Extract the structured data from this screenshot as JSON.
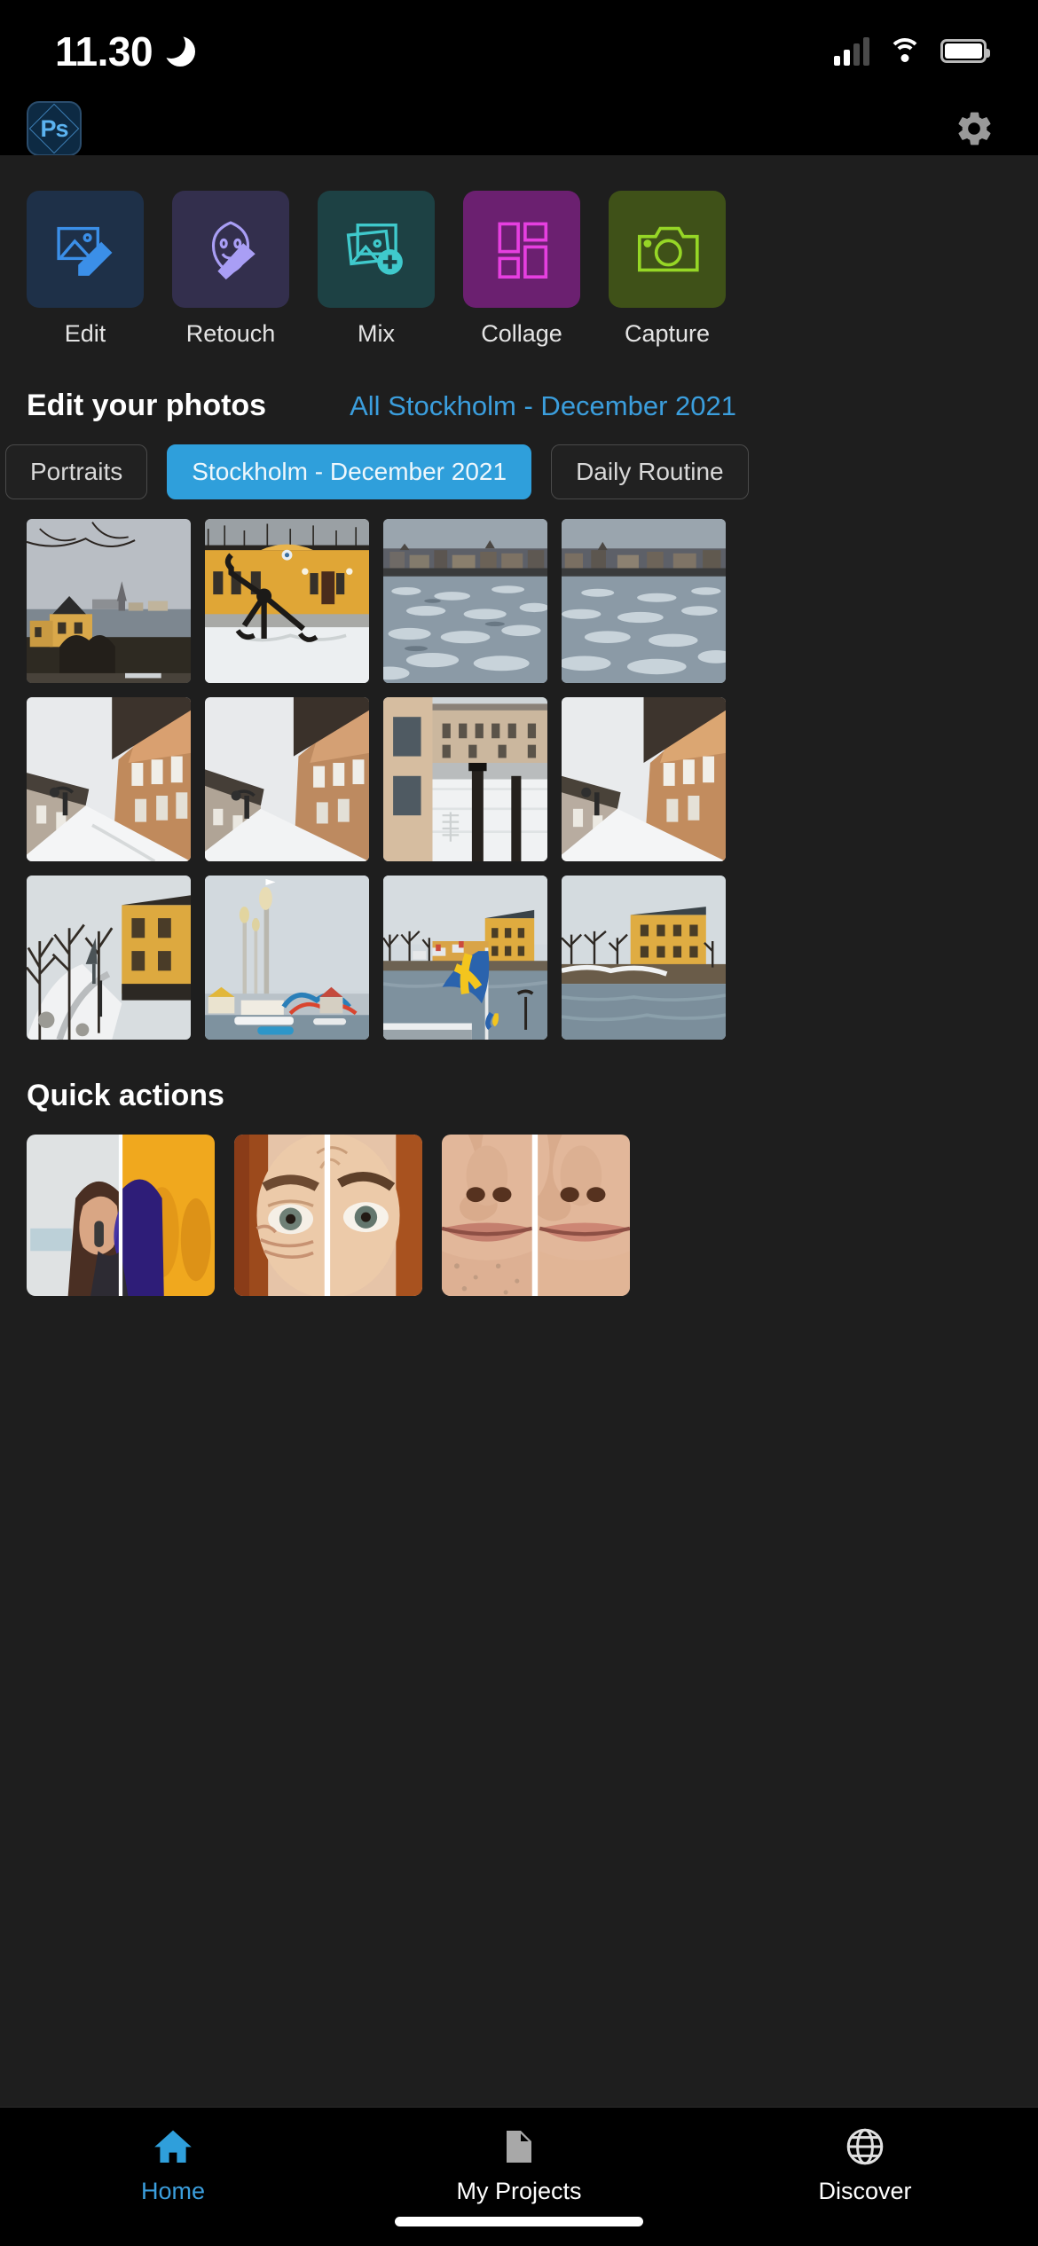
{
  "status_bar": {
    "time": "11.30",
    "dnd_icon": "moon-icon",
    "signal_icon": "signal-bars-icon",
    "wifi_icon": "wifi-icon",
    "battery_icon": "battery-icon"
  },
  "app_header": {
    "logo_text": "Ps",
    "logo_name": "photoshop-express-logo",
    "settings_icon": "gear-icon"
  },
  "tiles": [
    {
      "label": "Edit",
      "icon": "image-pencil-icon",
      "bg": "#1e3048",
      "fg": "#3b8fe8"
    },
    {
      "label": "Retouch",
      "icon": "face-brush-icon",
      "bg": "#332f4d",
      "fg": "#a99ef5"
    },
    {
      "label": "Mix",
      "icon": "image-plus-icon",
      "bg": "#1d4144",
      "fg": "#3fc9cc"
    },
    {
      "label": "Collage",
      "icon": "grid-layout-icon",
      "bg": "#6b2070",
      "fg": "#e63fe0"
    },
    {
      "label": "Capture",
      "icon": "camera-icon",
      "bg": "#3f5118",
      "fg": "#96d626"
    }
  ],
  "edit_section": {
    "title": "Edit your photos",
    "link": "All Stockholm - December 2021",
    "chips": [
      {
        "label": "Portraits",
        "active": false
      },
      {
        "label": "Stockholm - December 2021",
        "active": true
      },
      {
        "label": "Daily Routine",
        "active": false
      }
    ],
    "photos": [
      [
        {
          "name": "yellow-house-by-water-photo"
        },
        {
          "name": "anchor-yellow-building-photo"
        },
        {
          "name": "frozen-water-skyline-photo"
        },
        {
          "name": "frozen-water-skyline-2-photo"
        }
      ],
      [
        {
          "name": "snowy-street-buildings-photo"
        },
        {
          "name": "snowy-street-buildings-2-photo"
        },
        {
          "name": "rooftop-view-photo"
        },
        {
          "name": "snowy-street-buildings-3-photo"
        }
      ],
      [
        {
          "name": "snowy-park-path-photo"
        },
        {
          "name": "amusement-park-towers-photo"
        },
        {
          "name": "swedish-flag-harbour-photo"
        },
        {
          "name": "yellow-building-waterfront-photo"
        }
      ]
    ]
  },
  "quick_actions": {
    "title": "Quick actions",
    "cards": [
      {
        "name": "background-blur-card"
      },
      {
        "name": "wrinkle-removal-card"
      },
      {
        "name": "smooth-skin-card"
      }
    ]
  },
  "bottom_nav": {
    "items": [
      {
        "label": "Home",
        "icon": "home-icon",
        "active": true
      },
      {
        "label": "My Projects",
        "icon": "folder-icon",
        "active": false
      },
      {
        "label": "Discover",
        "icon": "globe-icon",
        "active": false
      }
    ]
  },
  "colors": {
    "accent": "#3b9edd",
    "chip_active": "#2f9fdb",
    "page_bg": "#1e1e1e",
    "bar_bg": "#000000"
  }
}
